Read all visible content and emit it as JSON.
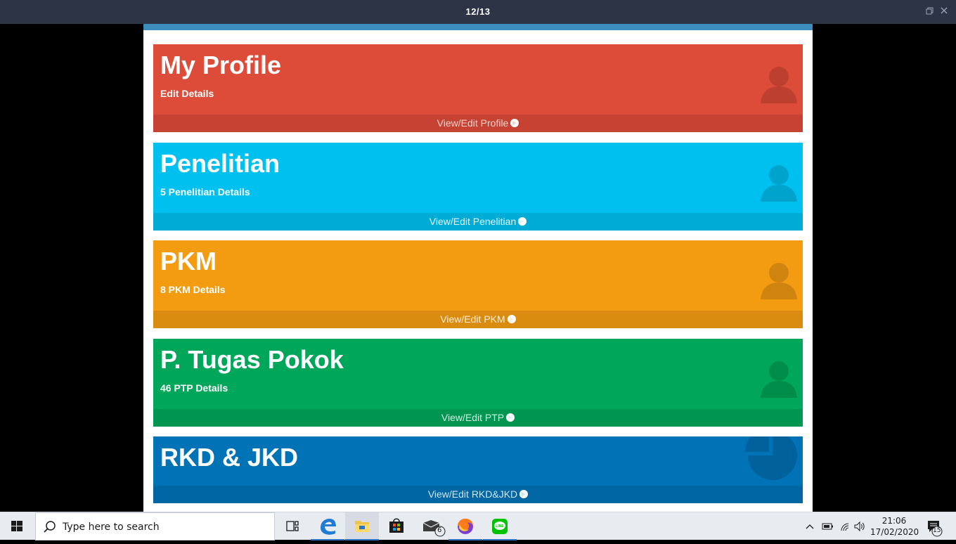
{
  "viewer": {
    "counter": "12/13"
  },
  "dashboard": {
    "boxes": [
      {
        "title": "My Profile",
        "subtitle": "Edit Details",
        "link": "View/Edit Profile",
        "icon": "user-icon",
        "color": "#dd4b39"
      },
      {
        "title": "Penelitian",
        "subtitle": "5 Penelitian Details",
        "link": "View/Edit Penelitian",
        "icon": "user-icon",
        "color": "#00c0ef"
      },
      {
        "title": "PKM",
        "subtitle": "8 PKM Details",
        "link": "View/Edit PKM",
        "icon": "user-icon",
        "color": "#f39c12"
      },
      {
        "title": "P. Tugas Pokok",
        "subtitle": "46 PTP Details",
        "link": "View/Edit PTP",
        "icon": "user-icon",
        "color": "#00a65a"
      },
      {
        "title": "RKD & JKD",
        "subtitle": "",
        "link": "View/Edit RKD&JKD",
        "icon": "pie-chart-icon",
        "color": "#0073b7"
      }
    ]
  },
  "taskbar": {
    "search_placeholder": "Type here to search",
    "mail_badge": "6",
    "notification_badge": "15",
    "time": "21:06",
    "date": "17/02/2020"
  }
}
